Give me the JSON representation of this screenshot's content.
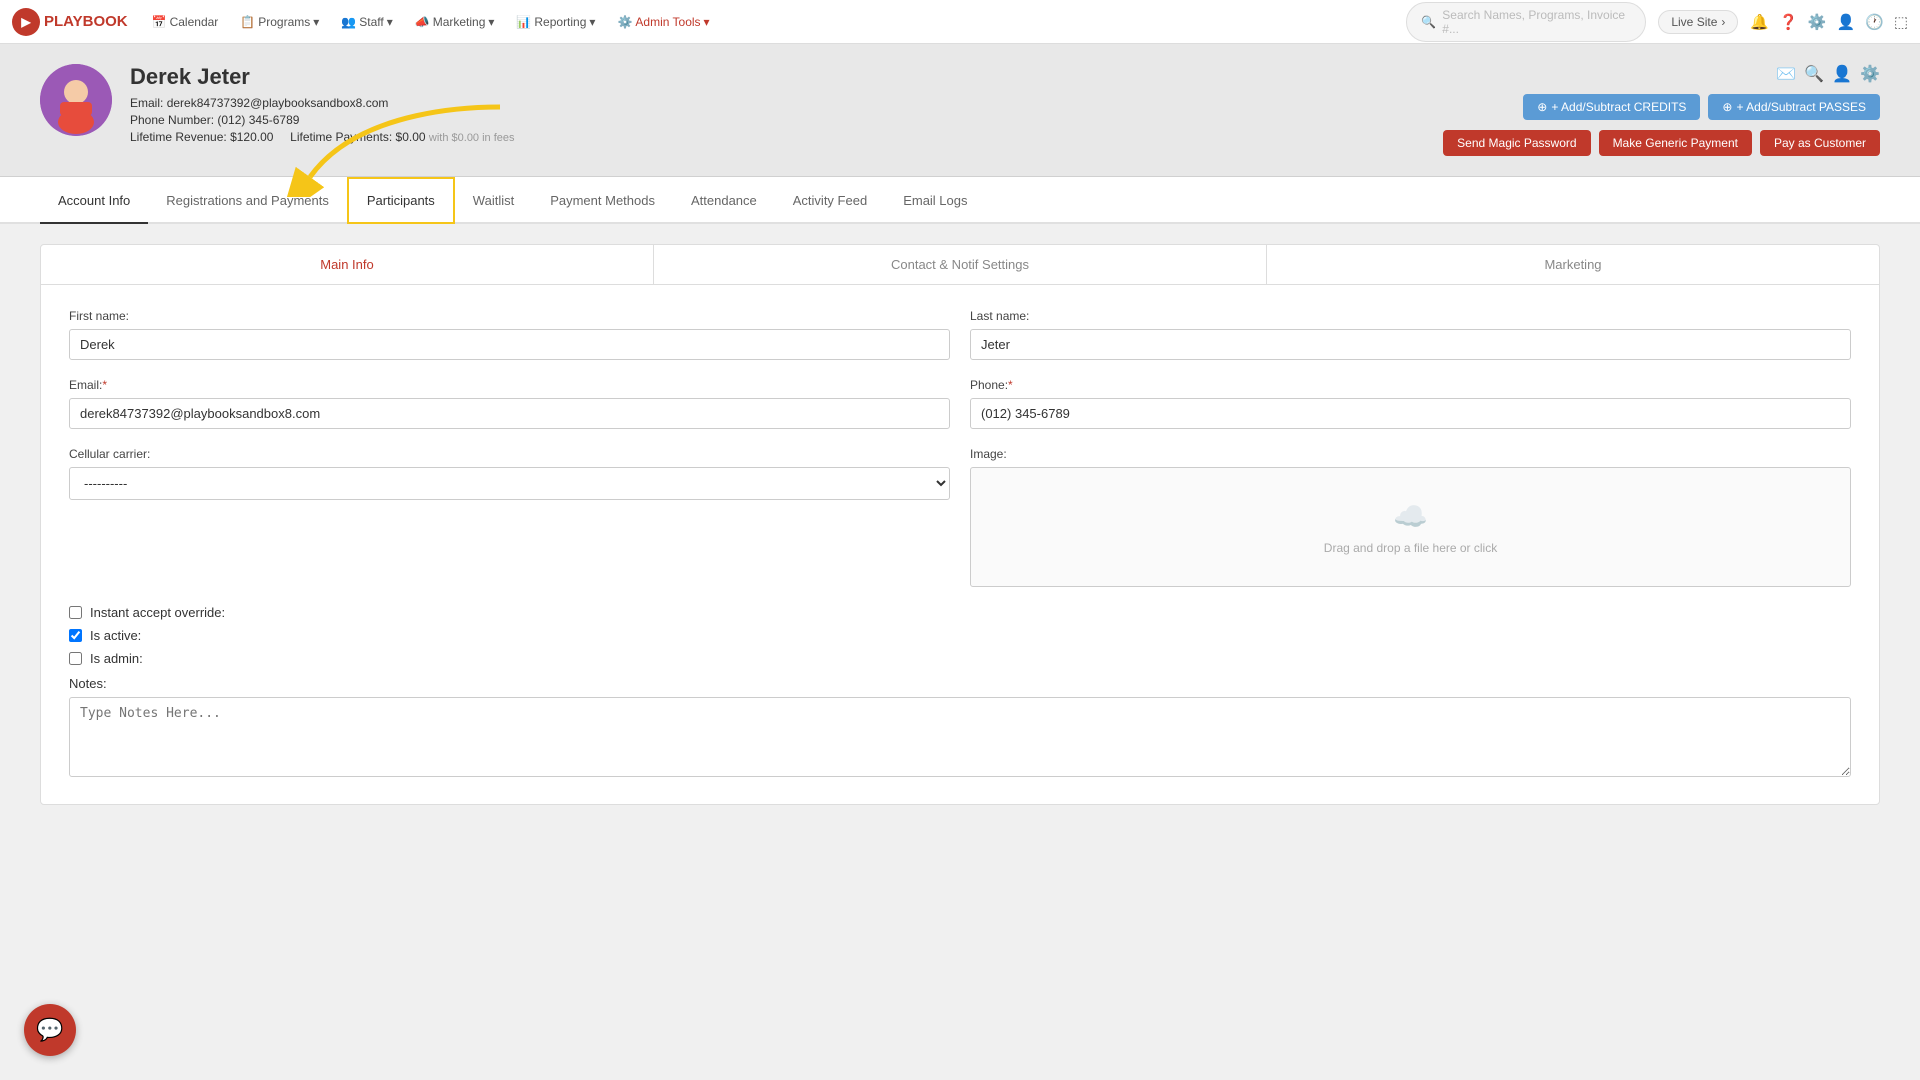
{
  "app": {
    "brand": "PLAYBOOK",
    "brand_icon": "▶"
  },
  "navbar": {
    "links": [
      {
        "label": "Calendar",
        "icon": "📅",
        "has_dropdown": false
      },
      {
        "label": "Programs",
        "icon": "📋",
        "has_dropdown": true
      },
      {
        "label": "Staff",
        "icon": "👥",
        "has_dropdown": true
      },
      {
        "label": "Marketing",
        "icon": "📣",
        "has_dropdown": true
      },
      {
        "label": "Reporting",
        "icon": "📊",
        "has_dropdown": true
      },
      {
        "label": "Admin Tools",
        "icon": "⚙️",
        "has_dropdown": true,
        "is_admin": true
      }
    ],
    "search_placeholder": "Search Names, Programs, Invoice #...",
    "live_site_label": "Live Site",
    "live_site_arrow": "›"
  },
  "profile": {
    "name": "Derek Jeter",
    "email_label": "Email:",
    "email": "derek84737392@playbooksandbox8.com",
    "phone_label": "Phone Number:",
    "phone": "(012) 345-6789",
    "lifetime_revenue_label": "Lifetime Revenue:",
    "lifetime_revenue": "$120.00",
    "lifetime_payments_label": "Lifetime Payments:",
    "lifetime_payments": "$0.00",
    "lifetime_payments_fees": "with $0.00 in fees"
  },
  "actions": {
    "add_credits_label": "+ Add/Subtract CREDITS",
    "add_passes_label": "+ Add/Subtract PASSES",
    "send_magic_label": "Send Magic Password",
    "make_generic_label": "Make Generic Payment",
    "pay_customer_label": "Pay as Customer"
  },
  "tabs": [
    {
      "label": "Account Info",
      "active": true
    },
    {
      "label": "Registrations and Payments",
      "active": false
    },
    {
      "label": "Participants",
      "active": false,
      "highlighted": true
    },
    {
      "label": "Waitlist",
      "active": false
    },
    {
      "label": "Payment Methods",
      "active": false
    },
    {
      "label": "Attendance",
      "active": false
    },
    {
      "label": "Activity Feed",
      "active": false
    },
    {
      "label": "Email Logs",
      "active": false
    }
  ],
  "form": {
    "tabs": [
      {
        "label": "Main Info",
        "active": true
      },
      {
        "label": "Contact & Notif Settings",
        "active": false
      },
      {
        "label": "Marketing",
        "active": false
      }
    ],
    "fields": {
      "first_name_label": "First name:",
      "first_name_value": "Derek",
      "last_name_label": "Last name:",
      "last_name_value": "Jeter",
      "email_label": "Email:",
      "email_req": "*",
      "email_value": "derek84737392@playbooksandbox8.com",
      "phone_label": "Phone:",
      "phone_req": "*",
      "phone_value": "(012) 345-6789",
      "cellular_carrier_label": "Cellular carrier:",
      "cellular_carrier_value": "----------",
      "image_label": "Image:",
      "image_upload_text": "Drag and drop a file here or click",
      "instant_accept_label": "Instant accept override:",
      "is_active_label": "Is active:",
      "is_admin_label": "Is admin:",
      "notes_label": "Notes:",
      "notes_placeholder": "Type Notes Here..."
    }
  },
  "chat": {
    "icon": "💬"
  }
}
